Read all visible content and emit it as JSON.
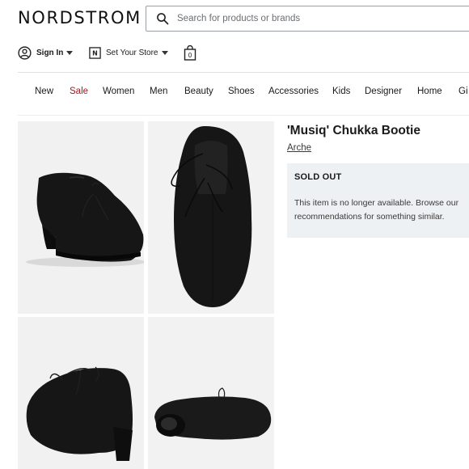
{
  "header": {
    "logo": "NORDSTROM",
    "search_placeholder": "Search for products or brands"
  },
  "utility": {
    "sign_in": "Sign In",
    "store": "Set Your Store",
    "bag_count": "0"
  },
  "nav": {
    "items": [
      "New",
      "Sale",
      "Women",
      "Men",
      "Beauty",
      "Shoes",
      "Accessories",
      "Kids",
      "Designer",
      "Home",
      "Gi"
    ]
  },
  "product": {
    "title": "'Musiq' Chukka Bootie",
    "brand": "Arche",
    "status_heading": "SOLD OUT",
    "status_message": "This item is no longer available. Browse our recommendations for something similar."
  },
  "colors": {
    "sale": "#9b1c22",
    "sold_box_bg": "#eef1f4",
    "shoe": "#161616"
  },
  "gallery": {
    "images": [
      "shoe-side-view",
      "shoe-top-view",
      "shoe-back-angle-view",
      "shoe-sole-view"
    ]
  }
}
